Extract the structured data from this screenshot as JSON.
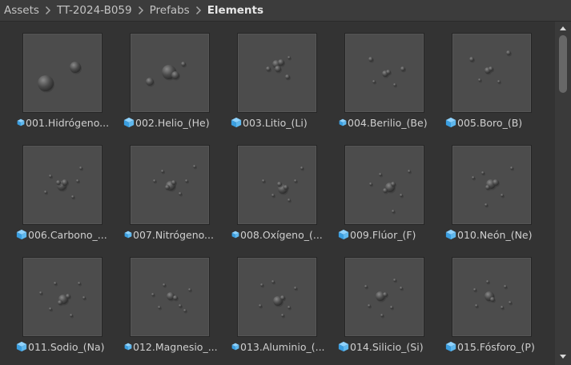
{
  "breadcrumb": [
    "Assets",
    "TT-2024-B059",
    "Prefabs",
    "Elements"
  ],
  "items": [
    {
      "label": "001.Hidrógeno...",
      "icon": "prefab-variant-icon"
    },
    {
      "label": "002.Helio_(He)",
      "icon": "prefab-icon"
    },
    {
      "label": "003.Litio_(Li)",
      "icon": "prefab-icon"
    },
    {
      "label": "004.Berilio_(Be)",
      "icon": "prefab-variant-icon"
    },
    {
      "label": "005.Boro_(B)",
      "icon": "prefab-icon"
    },
    {
      "label": "006.Carbono_...",
      "icon": "prefab-icon"
    },
    {
      "label": "007.Nitrógeno...",
      "icon": "prefab-variant-icon"
    },
    {
      "label": "008.Oxígeno_(...",
      "icon": "prefab-variant-icon"
    },
    {
      "label": "009.Flúor_(F)",
      "icon": "prefab-icon"
    },
    {
      "label": "010.Neón_(Ne)",
      "icon": "prefab-icon"
    },
    {
      "label": "011.Sodio_(Na)",
      "icon": "prefab-icon"
    },
    {
      "label": "012.Magnesio_...",
      "icon": "prefab-variant-icon"
    },
    {
      "label": "013.Aluminio_(...",
      "icon": "prefab-variant-icon"
    },
    {
      "label": "014.Silicio_(Si)",
      "icon": "prefab-icon"
    },
    {
      "label": "015.Fósforo_(P)",
      "icon": "prefab-icon"
    }
  ],
  "colors": {
    "prefab_icon": "#5fb8ee",
    "thumb_bg": "#4c4c4c",
    "panel_bg": "#333333"
  }
}
